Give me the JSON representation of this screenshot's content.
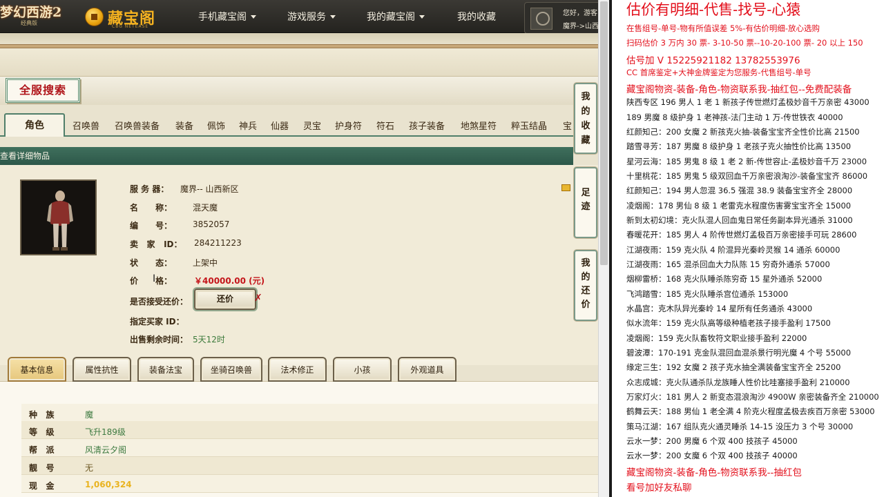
{
  "nav": {
    "game_logo": "梦幻西游2",
    "game_logo_sub": "经典版",
    "brand": "藏宝阁",
    "brand_en": "CBG NETEASE",
    "items": [
      {
        "label": "手机藏宝阁",
        "caret": true
      },
      {
        "label": "游戏服务",
        "caret": true
      },
      {
        "label": "我的藏宝阁",
        "caret": true
      },
      {
        "label": "我的收藏",
        "caret": false
      }
    ],
    "user_greeting": "您好，游客",
    "user_server": "魔界->山西"
  },
  "search": {
    "title": "全服搜索"
  },
  "category_tabs": [
    "角色",
    "召唤兽",
    "召唤兽装备",
    "装备",
    "佩饰",
    "神兵",
    "仙器",
    "灵宝",
    "护身符",
    "符石",
    "孩子装备",
    "地煞星符",
    "粹玉结晶",
    "宝"
  ],
  "detail_bar": "查看详细物品",
  "item": {
    "rows": [
      {
        "label": "服 务 器：",
        "value": "魔界-- 山西新区"
      },
      {
        "label": "名      称：",
        "value": "混天魔"
      },
      {
        "label": "编      号：",
        "value": "3852057"
      },
      {
        "label": "卖   家   ID：",
        "value": "284211223"
      },
      {
        "label": "状      态：",
        "value": "上架中"
      },
      {
        "label": "价      格：",
        "value": "￥40000.00 (元)"
      },
      {
        "label": "是否接受还价：",
        "value": ""
      },
      {
        "label": "指定买家 ID：",
        "value": ""
      },
      {
        "label": "出售剩余时间：",
        "value": "5天12时"
      }
    ],
    "bargain_button": "还价",
    "bargain_mark": "✗"
  },
  "side_buttons": [
    "我的收藏",
    "足迹",
    "我的还价"
  ],
  "attr_tabs": [
    "基本信息",
    "属性抗性",
    "装备法宝",
    "坐骑召唤兽",
    "法术修正",
    "小孩",
    "外观道具"
  ],
  "attr_rows": [
    {
      "key": "种   族",
      "value": "魔"
    },
    {
      "key": "等   级",
      "value": "飞升189级"
    },
    {
      "key": "帮   派",
      "value": "风清云夕阁"
    },
    {
      "key": "靓   号",
      "value": "无"
    },
    {
      "key": "现   金",
      "value": "1,060,324"
    }
  ],
  "notes": [
    "估价有明细-代售-找号-心猿",
    "在售组号-单号-物有所值误差 5%-有估价明细-放心选购",
    "扫码估价 3 万内 30 票- 3-10-50 票--10-20-100 票- 20 以上 150",
    "估号加 V 15225921182   13782553976",
    "CC 首席鉴定+大神金牌鉴定为您服务-代售组号-单号",
    "藏宝阁物资-装备-角色-物资联系我-抽红包--免费配装备",
    "陕西专区 196 男人 1 老 1 新孩子传世燃灯孟极妙音千万亲密 43000",
    "189 男魔 8 级护身 1 老神孩-法门主动 1 万-传世铁衣 40000",
    "红颜知己：200 女魔 2 新孩克火抽-装备宝宝齐全性价比高 21500",
    "踏雪寻芳：187 男魔 8 级护身 1 老孩子克火抽性价比高 13500",
    "星河云海：185 男鬼 8 级 1 老 2 新-传世容止-孟极妙音千万 23000",
    "十里桃花：185 男鬼 5 级双回血千万亲密浪淘沙-装备宝宝齐 86000",
    "红颜知己：194 男人忽混 36.5 强混 38.9 装备宝宝齐全 28000",
    "凌烟阁：178 男仙 8 级 1 老雷克水程度伤害雾宝宝齐全 15000",
    "新到太初幻境：克火队混人回血鬼日常任务副本异光通杀 31000",
    "春暖花开：185 男人 4 阶传世燃灯孟极百万亲密接手可玩 28600",
    "江湖夜雨：159 克火队 4 阶混异光秦岭灵猴 14 通杀 60000",
    "江湖夜雨：165 混杀回血大力队陈 15 穷奇外通杀 57000",
    "烟柳雷桥：168 克火队睡杀陈穷奇 15 星外通杀 52000",
    "飞鸿踏雪：185 克火队睡杀宫位通杀 153000",
    "水晶宫：克木队异光秦岭 14 星所有任务通杀 43000",
    "似水流年：159 克火队高等级种植老孩子接手盈利 17500",
    "凌烟阁：159 克火队畜牧符文职业接手盈利 22000",
    "碧波潭：170-191 克金队混回血混杀景行明光魔 4 个号 55000",
    "缘定三生：192 女魔 2 孩子克水抽全满装备宝宝齐全 25200",
    "众志成城：克火队通杀队龙族睡人性价比哇塞接手盈利 210000",
    "万家灯火：181 男人 2 新变态混浪淘沙 4900W 亲密装备齐全 210000",
    "鹤舞云天：188 男仙 1 老全满 4 阶克火程度孟极去疾百万亲密 53000",
    "策马江湖：167 组队克火通灵睡杀 14-15 没压力 3 个号 30000",
    "云水一梦：200 男魔 6 个双 400 技孩子 45000",
    "云水一梦：200 女魔 6 个双 400 技孩子 40000",
    "藏宝阁物资-装备-角色-物资联系我--抽红包",
    "看号加好友私聊"
  ],
  "colors": {
    "accent_green": "#4f7e69",
    "price_red": "#c4151a",
    "note_red": "#e3101c",
    "gold": "#e9b31f"
  }
}
